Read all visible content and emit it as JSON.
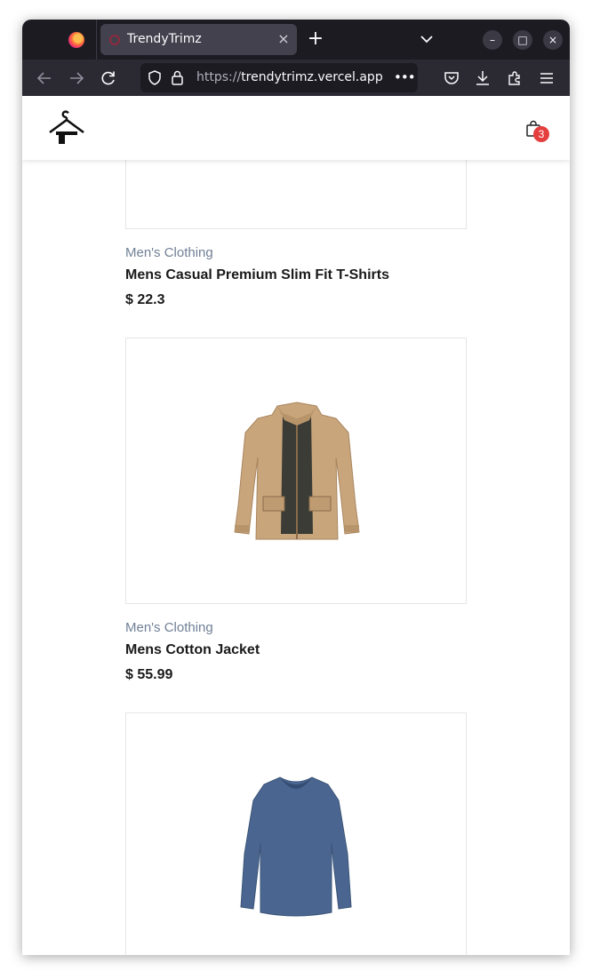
{
  "browser": {
    "tab_title": "TrendyTrimz",
    "url_protocol": "https://",
    "url_host": "trendytrimz.vercel.app",
    "url_more": "•••",
    "new_tab": "+",
    "tab_close": "×",
    "minimize": "–",
    "maximize": "□",
    "close": "×"
  },
  "header": {
    "cart_count": "3"
  },
  "products": [
    {
      "category": "Men's Clothing",
      "name": "Mens Casual Premium Slim Fit T-Shirts",
      "price": "$ 22.3"
    },
    {
      "category": "Men's Clothing",
      "name": "Mens Cotton Jacket",
      "price": "$ 55.99",
      "image": "khaki-cotton-jacket"
    },
    {
      "image": "blue-long-sleeve-shirt"
    }
  ],
  "colors": {
    "badge": "#e53e3e",
    "category_text": "#718096",
    "browser_chrome": "#1c1b22"
  }
}
